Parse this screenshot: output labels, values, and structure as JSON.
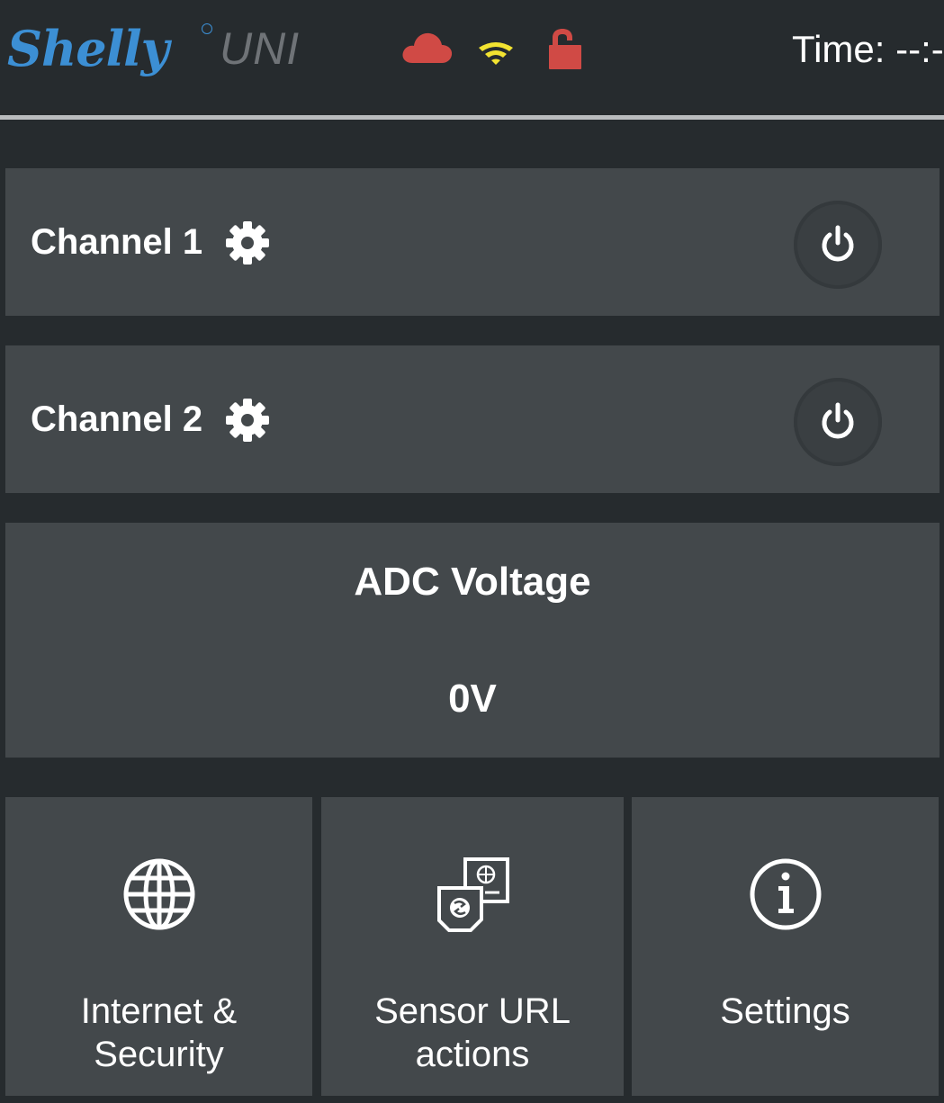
{
  "header": {
    "brand": "Shelly",
    "model": "UNI",
    "time_label": "Time: --:--",
    "status_icons": [
      {
        "icon": "cloud-icon",
        "color": "#d04a45"
      },
      {
        "icon": "wifi-icon",
        "color": "#f2e331"
      },
      {
        "icon": "unlocked-padlock-icon",
        "color": "#d04a45"
      }
    ]
  },
  "channels": [
    {
      "name": "Channel 1",
      "settings_icon": "gear-icon",
      "power_icon": "power-icon"
    },
    {
      "name": "Channel 2",
      "settings_icon": "gear-icon",
      "power_icon": "power-icon"
    }
  ],
  "adc": {
    "title": "ADC Voltage",
    "value": "0V"
  },
  "menu_tiles": [
    {
      "label_line1": "Internet &",
      "label_line2": "Security",
      "icon": "globe-icon"
    },
    {
      "label_line1": "Sensor URL",
      "label_line2": "actions",
      "icon": "url-actions-icon"
    },
    {
      "label_line1": "Settings",
      "label_line2": "",
      "icon": "info-icon"
    }
  ],
  "colors": {
    "background": "#262b2e",
    "panel": "#43484b",
    "brand_blue": "#3c8fd4",
    "alert_red": "#d04a45",
    "wifi_yellow": "#f2e331"
  }
}
